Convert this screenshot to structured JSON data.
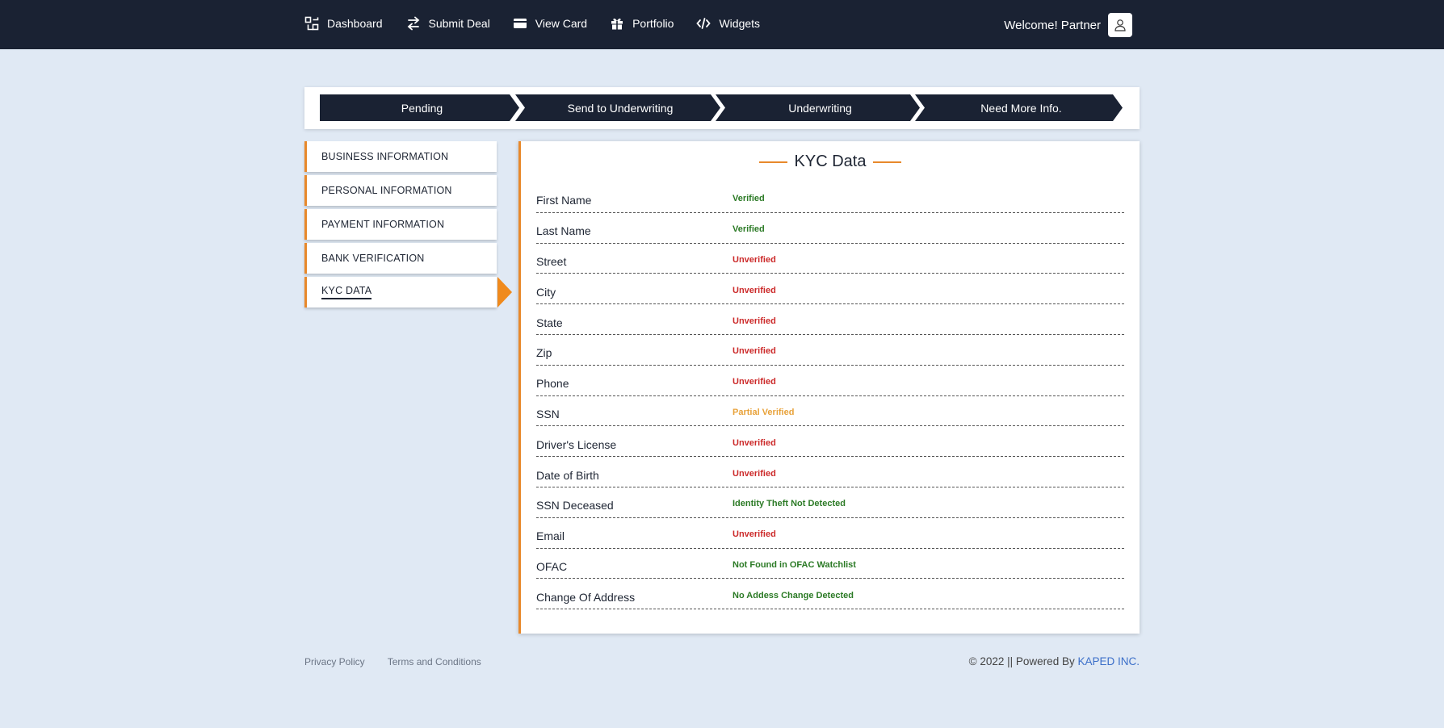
{
  "nav": {
    "items": [
      {
        "label": "Dashboard",
        "icon": "dashboard-icon"
      },
      {
        "label": "Submit Deal",
        "icon": "swap-icon"
      },
      {
        "label": "View Card",
        "icon": "card-icon"
      },
      {
        "label": "Portfolio",
        "icon": "gift-icon"
      },
      {
        "label": "Widgets",
        "icon": "code-icon"
      }
    ],
    "welcome": "Welcome! Partner"
  },
  "stepper": {
    "steps": [
      "Pending",
      "Send to Underwriting",
      "Underwriting",
      "Need More Info."
    ]
  },
  "sidebar": {
    "items": [
      {
        "label": "BUSINESS INFORMATION"
      },
      {
        "label": "PERSONAL INFORMATION"
      },
      {
        "label": "PAYMENT INFORMATION"
      },
      {
        "label": "BANK VERIFICATION"
      },
      {
        "label": "KYC DATA"
      }
    ],
    "active_index": 4
  },
  "kyc": {
    "title": "KYC Data",
    "rows": [
      {
        "field": "First Name",
        "status": "Verified",
        "color": "#2b7a25"
      },
      {
        "field": "Last Name",
        "status": "Verified",
        "color": "#2b7a25"
      },
      {
        "field": "Street",
        "status": "Unverified",
        "color": "#cc2a2a"
      },
      {
        "field": "City",
        "status": "Unverified",
        "color": "#cc2a2a"
      },
      {
        "field": "State",
        "status": "Unverified",
        "color": "#cc2a2a"
      },
      {
        "field": "Zip",
        "status": "Unverified",
        "color": "#cc2a2a"
      },
      {
        "field": "Phone",
        "status": "Unverified",
        "color": "#cc2a2a"
      },
      {
        "field": "SSN",
        "status": "Partial Verified",
        "color": "#e8a23a"
      },
      {
        "field": "Driver's License",
        "status": "Unverified",
        "color": "#cc2a2a"
      },
      {
        "field": "Date of Birth",
        "status": "Unverified",
        "color": "#cc2a2a"
      },
      {
        "field": "SSN Deceased",
        "status": "Identity Theft Not Detected",
        "color": "#2b7a25"
      },
      {
        "field": "Email",
        "status": "Unverified",
        "color": "#cc2a2a"
      },
      {
        "field": "OFAC",
        "status": "Not Found in OFAC Watchlist",
        "color": "#2b7a25"
      },
      {
        "field": "Change Of Address",
        "status": "No Addess Change Detected",
        "color": "#2b7a25"
      }
    ]
  },
  "footer": {
    "privacy": "Privacy Policy",
    "terms": "Terms and Conditions",
    "copyright": "© 2022 || Powered By ",
    "brand": "KAPED INC."
  },
  "colors": {
    "navbar": "#1a2233",
    "accent": "#e8892b",
    "background": "#e0e9f4",
    "link": "#3b6fc9"
  }
}
